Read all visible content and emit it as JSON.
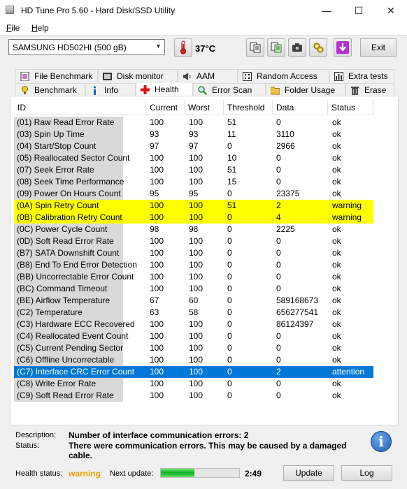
{
  "window": {
    "title": "HD Tune Pro 5.60 - Hard Disk/SSD Utility",
    "minimize": "—",
    "maximize": "☐",
    "close": "✕"
  },
  "menu": [
    {
      "label": "File",
      "accel": "F"
    },
    {
      "label": "Help",
      "accel": "H"
    }
  ],
  "toolbar": {
    "drive": "SAMSUNG HD502HI (500 gB)",
    "temperature": "37°C",
    "exit_label": "Exit"
  },
  "tabs_top": [
    {
      "label": "File Benchmark",
      "icon": "file-benchmark-icon"
    },
    {
      "label": "Disk monitor",
      "icon": "disk-monitor-icon"
    },
    {
      "label": "AAM",
      "icon": "speaker-icon"
    },
    {
      "label": "Random Access",
      "icon": "random-access-icon"
    },
    {
      "label": "Extra tests",
      "icon": "extra-tests-icon"
    }
  ],
  "tabs_bottom": [
    {
      "label": "Benchmark",
      "icon": "benchmark-icon"
    },
    {
      "label": "Info",
      "icon": "info-icon"
    },
    {
      "label": "Health",
      "icon": "health-cross-icon"
    },
    {
      "label": "Error Scan",
      "icon": "magnifier-icon"
    },
    {
      "label": "Folder Usage",
      "icon": "folder-icon"
    },
    {
      "label": "Erase",
      "icon": "trash-icon"
    }
  ],
  "active_tab": "Health",
  "table": {
    "columns": [
      "ID",
      "Current",
      "Worst",
      "Threshold",
      "Data",
      "Status"
    ],
    "rows": [
      {
        "id": "(01) Raw Read Error Rate",
        "current": "100",
        "worst": "100",
        "threshold": "51",
        "data": "0",
        "status": "ok"
      },
      {
        "id": "(03) Spin Up Time",
        "current": "93",
        "worst": "93",
        "threshold": "11",
        "data": "3110",
        "status": "ok"
      },
      {
        "id": "(04) Start/Stop Count",
        "current": "97",
        "worst": "97",
        "threshold": "0",
        "data": "2966",
        "status": "ok"
      },
      {
        "id": "(05) Reallocated Sector Count",
        "current": "100",
        "worst": "100",
        "threshold": "10",
        "data": "0",
        "status": "ok"
      },
      {
        "id": "(07) Seek Error Rate",
        "current": "100",
        "worst": "100",
        "threshold": "51",
        "data": "0",
        "status": "ok"
      },
      {
        "id": "(08) Seek Time Performance",
        "current": "100",
        "worst": "100",
        "threshold": "15",
        "data": "0",
        "status": "ok"
      },
      {
        "id": "(09) Power On Hours Count",
        "current": "95",
        "worst": "95",
        "threshold": "0",
        "data": "23375",
        "status": "ok"
      },
      {
        "id": "(0A) Spin Retry Count",
        "current": "100",
        "worst": "100",
        "threshold": "51",
        "data": "2",
        "status": "warning",
        "highlight": "warning"
      },
      {
        "id": "(0B) Calibration Retry Count",
        "current": "100",
        "worst": "100",
        "threshold": "0",
        "data": "4",
        "status": "warning",
        "highlight": "warning"
      },
      {
        "id": "(0C) Power Cycle Count",
        "current": "98",
        "worst": "98",
        "threshold": "0",
        "data": "2225",
        "status": "ok"
      },
      {
        "id": "(0D) Soft Read Error Rate",
        "current": "100",
        "worst": "100",
        "threshold": "0",
        "data": "0",
        "status": "ok"
      },
      {
        "id": "(B7) SATA Downshift Count",
        "current": "100",
        "worst": "100",
        "threshold": "0",
        "data": "0",
        "status": "ok"
      },
      {
        "id": "(B8) End To End Error Detection",
        "current": "100",
        "worst": "100",
        "threshold": "0",
        "data": "0",
        "status": "ok"
      },
      {
        "id": "(BB) Uncorrectable Error Count",
        "current": "100",
        "worst": "100",
        "threshold": "0",
        "data": "0",
        "status": "ok"
      },
      {
        "id": "(BC) Command Timeout",
        "current": "100",
        "worst": "100",
        "threshold": "0",
        "data": "0",
        "status": "ok"
      },
      {
        "id": "(BE) Airflow Temperature",
        "current": "67",
        "worst": "60",
        "threshold": "0",
        "data": "589168673",
        "status": "ok"
      },
      {
        "id": "(C2) Temperature",
        "current": "63",
        "worst": "58",
        "threshold": "0",
        "data": "656277541",
        "status": "ok"
      },
      {
        "id": "(C3) Hardware ECC Recovered",
        "current": "100",
        "worst": "100",
        "threshold": "0",
        "data": "86124397",
        "status": "ok"
      },
      {
        "id": "(C4) Reallocated Event Count",
        "current": "100",
        "worst": "100",
        "threshold": "0",
        "data": "0",
        "status": "ok"
      },
      {
        "id": "(C5) Current Pending Sector",
        "current": "100",
        "worst": "100",
        "threshold": "0",
        "data": "0",
        "status": "ok"
      },
      {
        "id": "(C6) Offline Uncorrectable",
        "current": "100",
        "worst": "100",
        "threshold": "0",
        "data": "0",
        "status": "ok"
      },
      {
        "id": "(C7) Interface CRC Error Count",
        "current": "100",
        "worst": "100",
        "threshold": "0",
        "data": "2",
        "status": "attention",
        "highlight": "selected"
      },
      {
        "id": "(C8) Write Error Rate",
        "current": "100",
        "worst": "100",
        "threshold": "0",
        "data": "0",
        "status": "ok"
      },
      {
        "id": "(C9) Soft Read Error Rate",
        "current": "100",
        "worst": "100",
        "threshold": "0",
        "data": "0",
        "status": "ok"
      }
    ]
  },
  "details": {
    "description_label": "Description:",
    "description": "Number of interface communication errors: 2",
    "status_label": "Status:",
    "status_line1": "There were communication errors. This may be caused by a damaged",
    "status_line2": "cable."
  },
  "footer": {
    "health_label": "Health status:",
    "health_value": "warning",
    "next_update_label": "Next update:",
    "progress": 0.43,
    "time": "2:49",
    "update_label": "Update",
    "log_label": "Log"
  },
  "colors": {
    "warning_row": "#ffff00",
    "selected_row": "#0078d7",
    "health_warning_text": "#f0a000",
    "progress": "#06b025"
  }
}
